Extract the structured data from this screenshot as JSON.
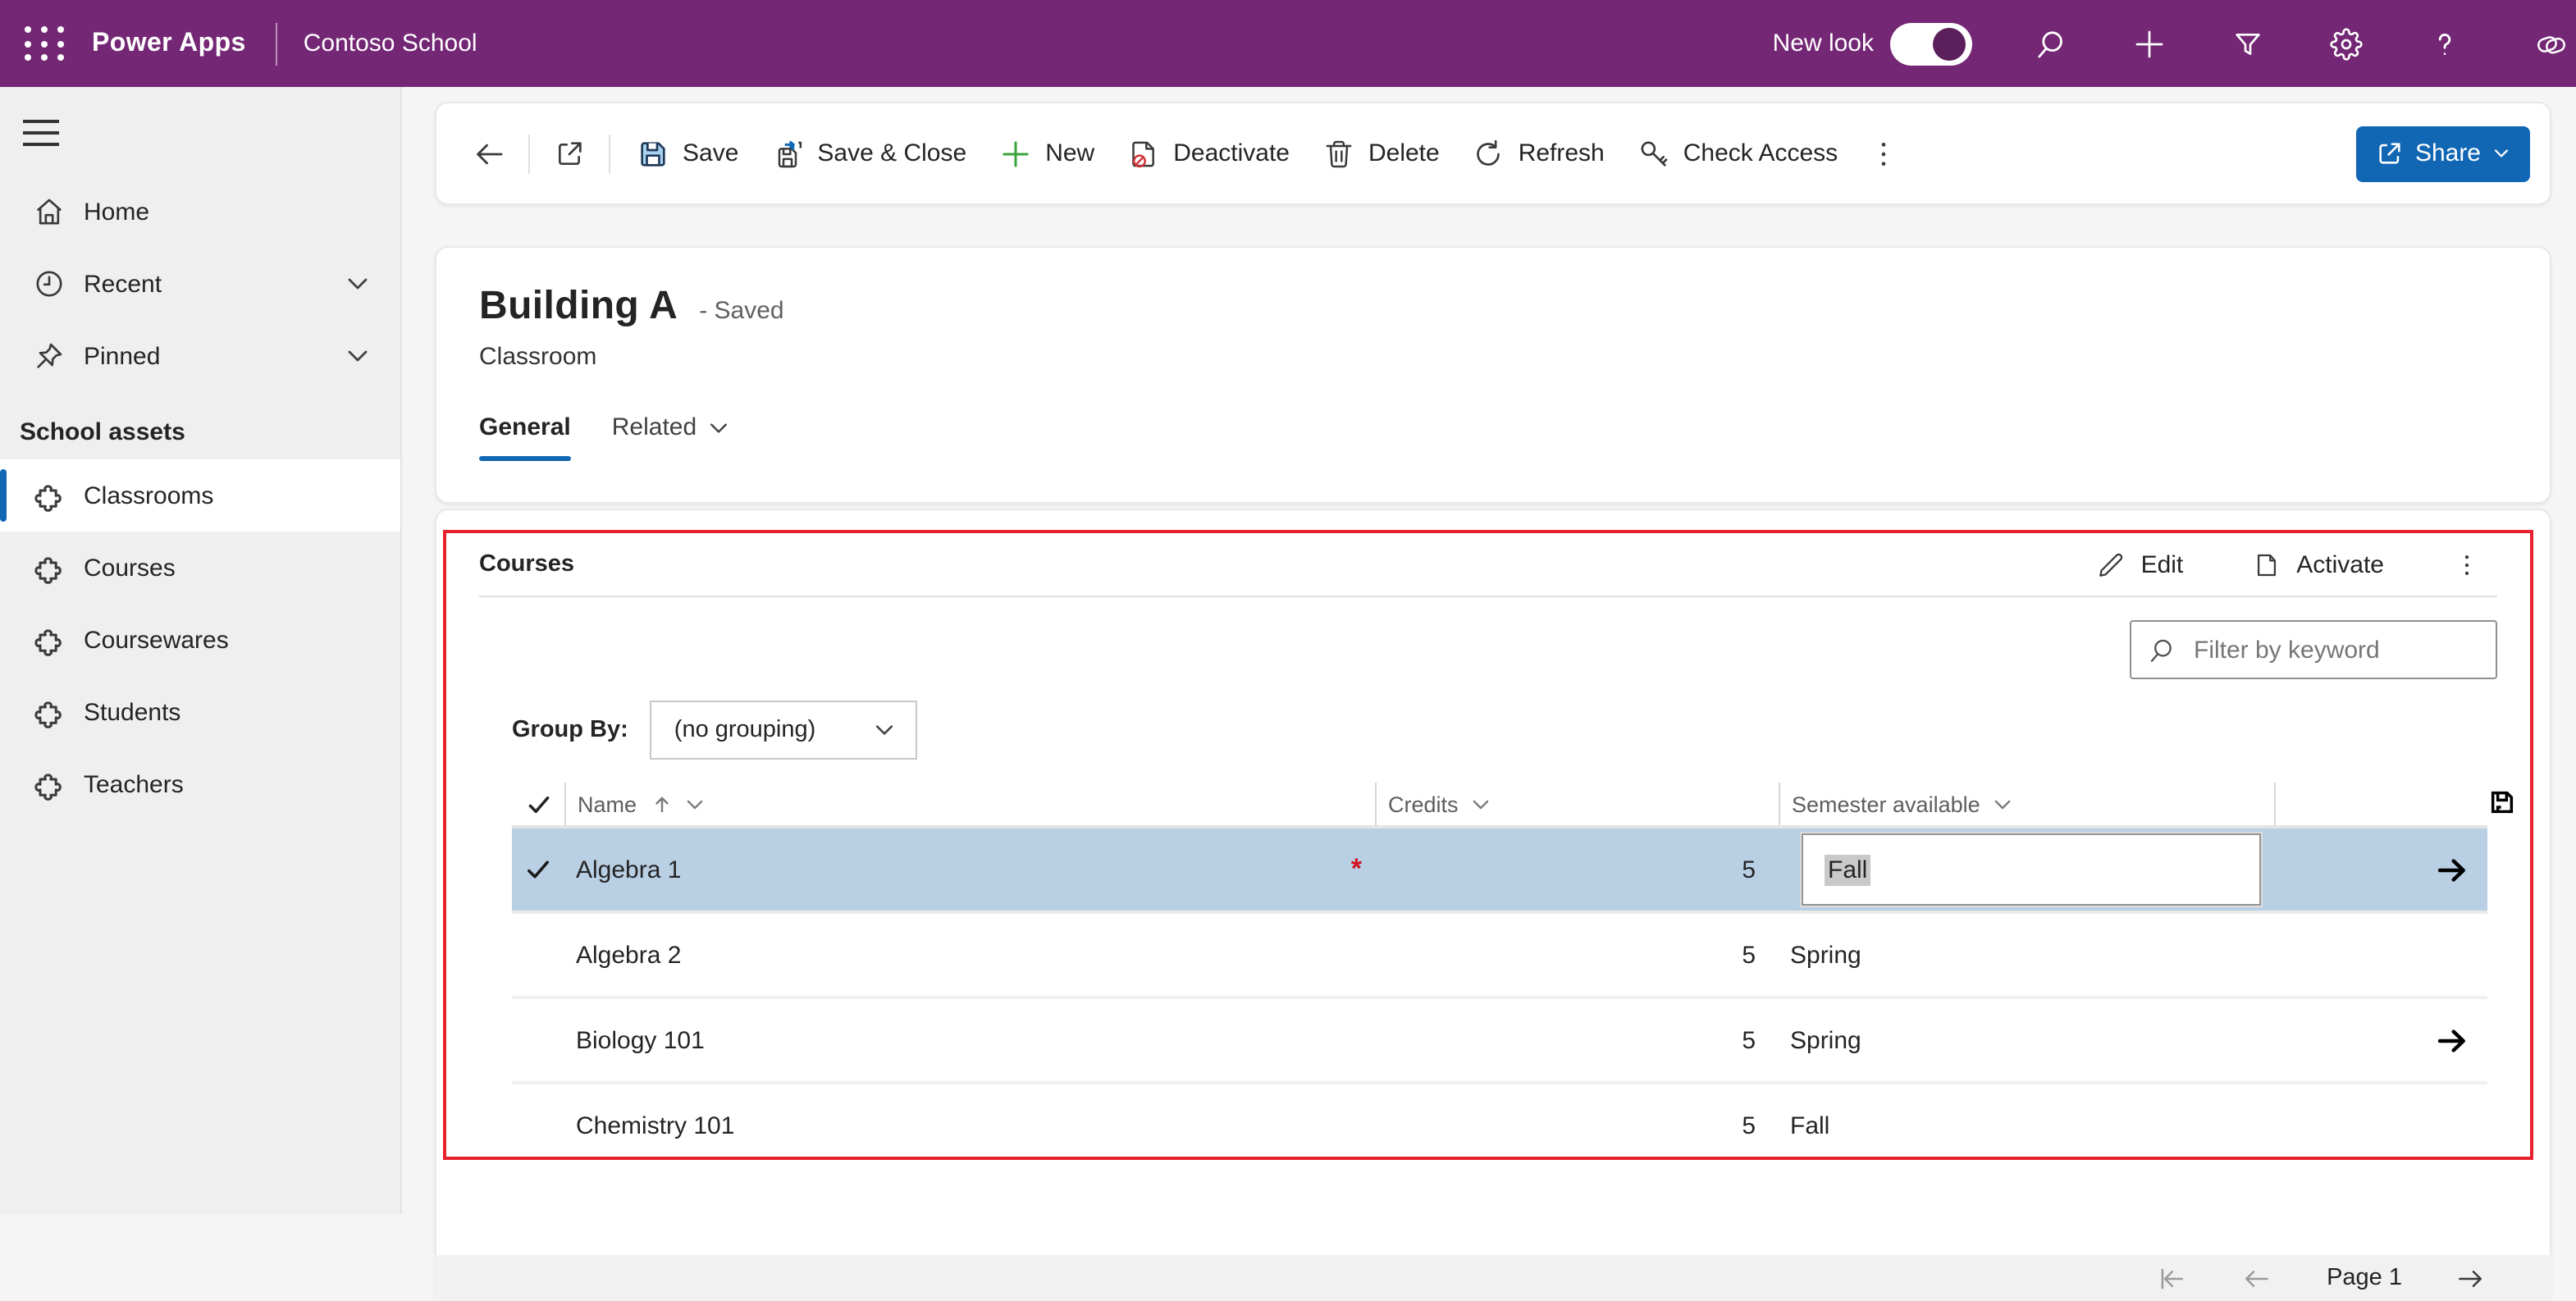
{
  "colors": {
    "topbar_purple": "#742774",
    "accent_blue": "#1267b4",
    "selected_row_blue": "#b9cfe4",
    "highlight_red_border": "#e8212e",
    "required_red": "#d11422",
    "new_green": "#3ba33b",
    "save_fill_blue": "#a9d2f0"
  },
  "topbar": {
    "product": "Power Apps",
    "app_name": "Contoso School",
    "new_look_label": "New look",
    "new_look_state": "on",
    "icons": [
      "search-icon",
      "add-icon",
      "filter-icon",
      "settings-icon",
      "help-icon",
      "copilot-icon"
    ]
  },
  "sidebar": {
    "items": [
      {
        "label": "Home",
        "icon": "home-icon"
      },
      {
        "label": "Recent",
        "icon": "clock-icon",
        "expandable": true
      },
      {
        "label": "Pinned",
        "icon": "pin-icon",
        "expandable": true
      }
    ],
    "section_label": "School assets",
    "entities": [
      {
        "label": "Classrooms",
        "icon": "puzzle-icon",
        "selected": true
      },
      {
        "label": "Courses",
        "icon": "puzzle-icon"
      },
      {
        "label": "Coursewares",
        "icon": "puzzle-icon"
      },
      {
        "label": "Students",
        "icon": "puzzle-icon"
      },
      {
        "label": "Teachers",
        "icon": "puzzle-icon"
      }
    ]
  },
  "command_bar": {
    "buttons": [
      {
        "label": "Save",
        "icon": "save-icon"
      },
      {
        "label": "Save & Close",
        "icon": "save-close-icon"
      },
      {
        "label": "New",
        "icon": "new-plus-icon"
      },
      {
        "label": "Deactivate",
        "icon": "deactivate-icon"
      },
      {
        "label": "Delete",
        "icon": "delete-icon"
      },
      {
        "label": "Refresh",
        "icon": "refresh-icon"
      },
      {
        "label": "Check Access",
        "icon": "key-icon"
      }
    ],
    "share_label": "Share"
  },
  "record": {
    "title": "Building A",
    "status": "- Saved",
    "entity_type": "Classroom",
    "tabs": [
      {
        "label": "General",
        "active": true
      },
      {
        "label": "Related",
        "has_dropdown": true
      }
    ]
  },
  "subgrid": {
    "title": "Courses",
    "actions": [
      {
        "label": "Edit",
        "icon": "pencil-icon"
      },
      {
        "label": "Activate",
        "icon": "page-icon"
      }
    ],
    "filter_placeholder": "Filter by keyword",
    "group_by_label": "Group By:",
    "group_by_value": "(no grouping)",
    "columns": [
      "Name",
      "Credits",
      "Semester available"
    ],
    "sort": {
      "column": "Name",
      "direction": "ascending"
    },
    "rows": [
      {
        "name": "Algebra 1",
        "credits": "5",
        "semester": "Fall",
        "selected": true,
        "editing_semester": true,
        "required_marker": "*",
        "has_arrow": true
      },
      {
        "name": "Algebra 2",
        "credits": "5",
        "semester": "Spring"
      },
      {
        "name": "Biology 101",
        "credits": "5",
        "semester": "Spring",
        "has_arrow": true
      },
      {
        "name": "Chemistry 101",
        "credits": "5",
        "semester": "Fall"
      }
    ],
    "pagination": {
      "page_label": "Page 1"
    }
  }
}
